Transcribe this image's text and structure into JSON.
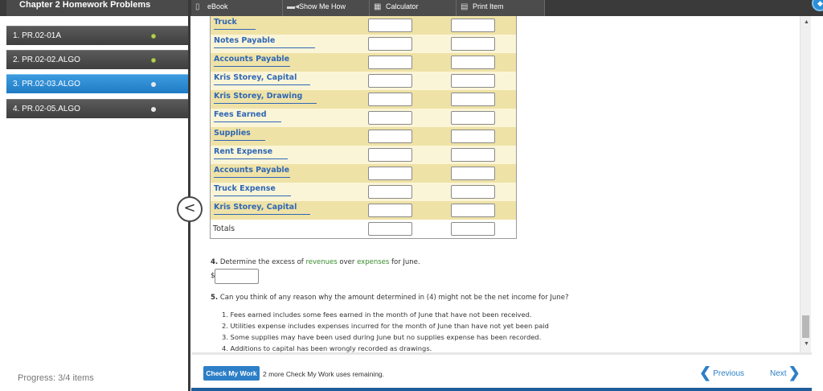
{
  "topbar": {
    "chapter_title": "Chapter 2 Homework Problems",
    "ebook": "eBook",
    "show_me_how": "Show Me How",
    "calculator": "Calculator",
    "print_item": "Print Item"
  },
  "sidebar": {
    "items": [
      {
        "label": "1. PR.02-01A",
        "state": "done"
      },
      {
        "label": "2. PR.02-02.ALGO",
        "state": "done"
      },
      {
        "label": "3. PR.02-03.ALGO",
        "state": "active"
      },
      {
        "label": "4. PR.02-05.ALGO",
        "state": "pending"
      }
    ],
    "progress": "Progress: 3/4 items"
  },
  "table": {
    "accounts": [
      "Truck",
      "Notes Payable",
      "Accounts Payable",
      "Kris Storey, Capital",
      "Kris Storey, Drawing",
      "Fees Earned",
      "Supplies",
      "Rent Expense",
      "Accounts Payable",
      "Truck Expense",
      "Kris Storey, Capital"
    ],
    "totals_label": "Totals"
  },
  "questions": {
    "q4_num": "4.",
    "q4_text_a": "Determine the excess of",
    "q4_revenues": "revenues",
    "q4_text_b": "over",
    "q4_expenses": "expenses",
    "q4_text_c": "for June.",
    "q4_dollar": "$",
    "q5_num": "5.",
    "q5_text": "Can you think of any reason why the amount determined in (4) might not be the net income for June?",
    "q5_options": [
      "1. Fees earned includes some fees earned in the month of June that have not been received.",
      "2. Utilities expense includes expenses incurred for the month of June than have not yet been paid",
      "3. Some supplies may have been used during June but no supplies expense has been recorded.",
      "4. Additions to capital has been wrongly recorded as drawings."
    ]
  },
  "footer": {
    "check_my_work": "Check My Work",
    "check_note": "2 more Check My Work uses remaining.",
    "previous": "Previous",
    "next": "Next"
  },
  "colors": {
    "accent_blue": "#2d7fc7",
    "table_shade": "#efe2a6",
    "table_light": "#fbf5d8",
    "account_link": "#2f67b5",
    "highlight_green": "#3a8a2e"
  }
}
